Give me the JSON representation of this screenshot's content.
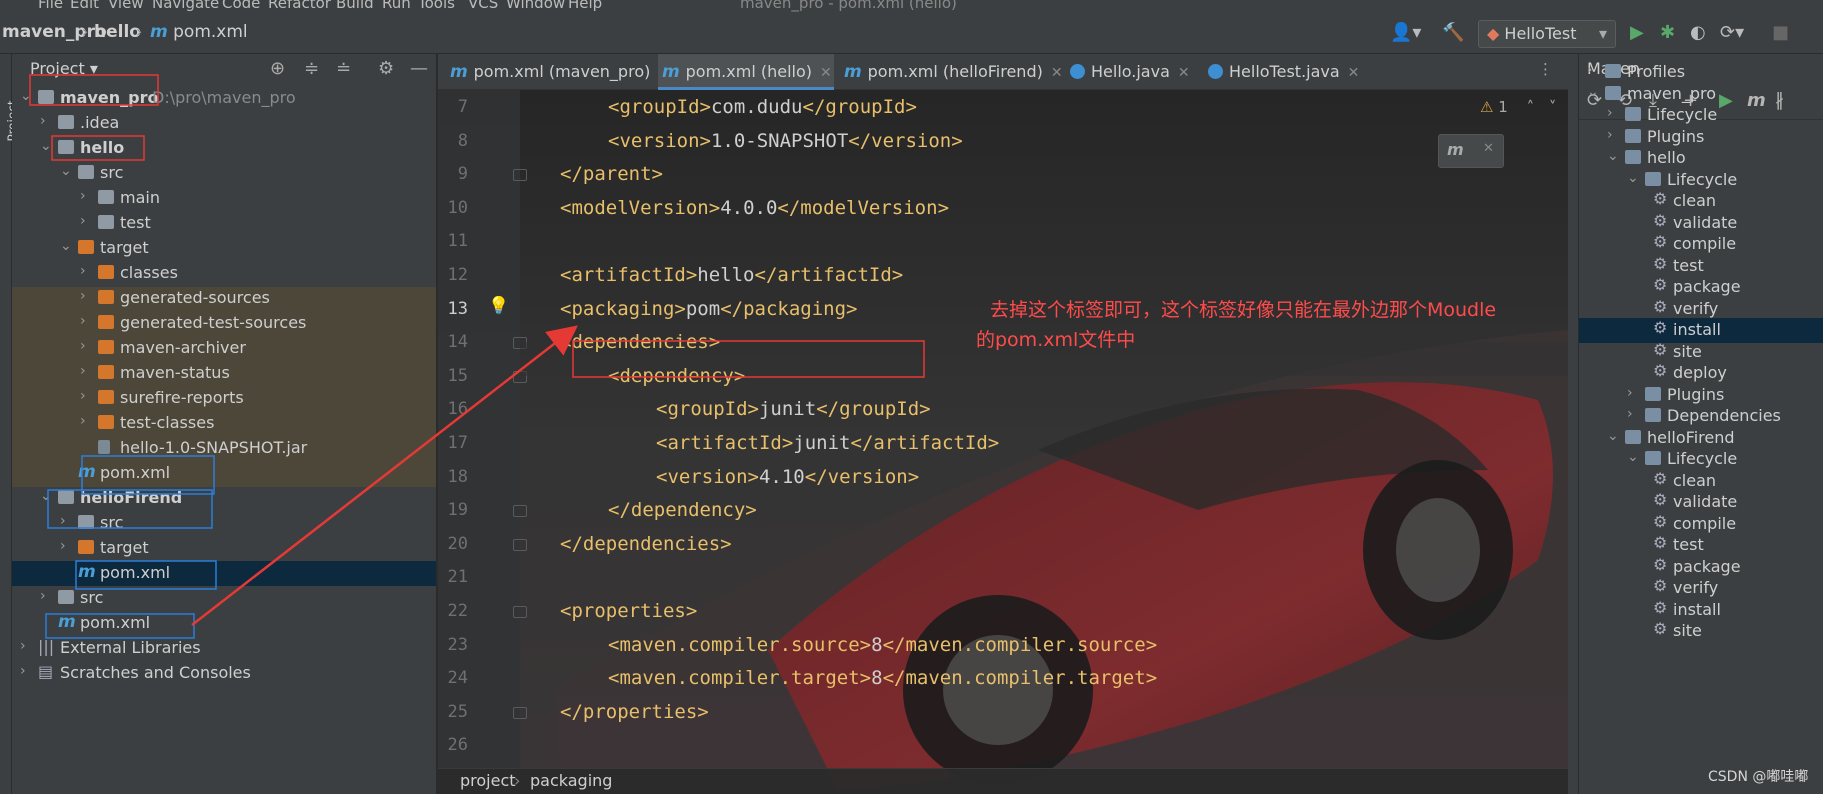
{
  "menu": {
    "items": [
      "File",
      "Edit",
      "View",
      "Navigate",
      "Code",
      "Refactor",
      "Build",
      "Run",
      "Tools",
      "VCS",
      "Window",
      "Help"
    ],
    "window_title": "maven_pro - pom.xml (hello)"
  },
  "navbar": {
    "crumbs": [
      "maven_pro",
      "hello",
      "pom.xml"
    ],
    "run_config": "HelloTest"
  },
  "project": {
    "title": "Project",
    "tree": [
      {
        "label": "maven_pro",
        "path": "D:\\pro\\maven_pro",
        "depth": 0,
        "expanded": true,
        "icon": "module-folder-icon",
        "bold": true
      },
      {
        "label": ".idea",
        "depth": 1,
        "expanded": false,
        "icon": "folder-icon"
      },
      {
        "label": "hello",
        "depth": 1,
        "expanded": true,
        "icon": "module-folder-icon",
        "bold": true
      },
      {
        "label": "src",
        "depth": 2,
        "expanded": true,
        "icon": "folder-icon"
      },
      {
        "label": "main",
        "depth": 3,
        "expanded": false,
        "icon": "folder-icon"
      },
      {
        "label": "test",
        "depth": 3,
        "expanded": false,
        "icon": "folder-icon"
      },
      {
        "label": "target",
        "depth": 2,
        "expanded": true,
        "icon": "excluded-folder-icon"
      },
      {
        "label": "classes",
        "depth": 3,
        "expanded": false,
        "icon": "excluded-folder-icon"
      },
      {
        "label": "generated-sources",
        "depth": 3,
        "expanded": false,
        "icon": "excluded-folder-icon"
      },
      {
        "label": "generated-test-sources",
        "depth": 3,
        "expanded": false,
        "icon": "excluded-folder-icon"
      },
      {
        "label": "maven-archiver",
        "depth": 3,
        "expanded": false,
        "icon": "excluded-folder-icon"
      },
      {
        "label": "maven-status",
        "depth": 3,
        "expanded": false,
        "icon": "excluded-folder-icon"
      },
      {
        "label": "surefire-reports",
        "depth": 3,
        "expanded": false,
        "icon": "excluded-folder-icon"
      },
      {
        "label": "test-classes",
        "depth": 3,
        "expanded": false,
        "icon": "excluded-folder-icon"
      },
      {
        "label": "hello-1.0-SNAPSHOT.jar",
        "depth": 3,
        "icon": "jar-icon"
      },
      {
        "label": "pom.xml",
        "depth": 2,
        "icon": "maven-file-icon"
      },
      {
        "label": "helloFirend",
        "depth": 1,
        "expanded": true,
        "icon": "module-folder-icon",
        "bold": true
      },
      {
        "label": "src",
        "depth": 2,
        "expanded": false,
        "icon": "folder-icon"
      },
      {
        "label": "target",
        "depth": 2,
        "expanded": false,
        "icon": "excluded-folder-icon"
      },
      {
        "label": "pom.xml",
        "depth": 2,
        "icon": "maven-file-icon",
        "selected": true
      },
      {
        "label": "src",
        "depth": 1,
        "expanded": false,
        "icon": "folder-icon"
      },
      {
        "label": "pom.xml",
        "depth": 1,
        "icon": "maven-file-icon"
      },
      {
        "label": "External Libraries",
        "depth": 0,
        "expanded": false,
        "icon": "library-icon"
      },
      {
        "label": "Scratches and Consoles",
        "depth": 0,
        "expanded": false,
        "icon": "scratches-icon"
      }
    ]
  },
  "tabs": [
    {
      "label": "pom.xml (maven_pro)",
      "icon": "maven-file-icon",
      "active": false
    },
    {
      "label": "pom.xml (hello)",
      "icon": "maven-file-icon",
      "active": true
    },
    {
      "label": "pom.xml (helloFirend)",
      "icon": "maven-file-icon",
      "active": false
    },
    {
      "label": "Hello.java",
      "icon": "java-class-icon",
      "active": false
    },
    {
      "label": "HelloTest.java",
      "icon": "java-class-icon",
      "active": false
    }
  ],
  "editor": {
    "inspection_count": "1",
    "current_line": 13,
    "lines": [
      {
        "n": "7",
        "indent": 1,
        "tag": "groupId",
        "text": "com.dudu"
      },
      {
        "n": "8",
        "indent": 1,
        "tag": "version",
        "text": "1.0-SNAPSHOT"
      },
      {
        "n": "9",
        "indent": 0,
        "close": "parent"
      },
      {
        "n": "10",
        "indent": 0,
        "tag": "modelVersion",
        "text": "4.0.0"
      },
      {
        "n": "11",
        "indent": 0
      },
      {
        "n": "12",
        "indent": 0,
        "tag": "artifactId",
        "text": "hello"
      },
      {
        "n": "13",
        "indent": 0,
        "tag": "packaging",
        "text": "pom"
      },
      {
        "n": "14",
        "indent": 0,
        "open": "dependencies"
      },
      {
        "n": "15",
        "indent": 1,
        "open": "dependency"
      },
      {
        "n": "16",
        "indent": 2,
        "tag": "groupId",
        "text": "junit"
      },
      {
        "n": "17",
        "indent": 2,
        "tag": "artifactId",
        "text": "junit"
      },
      {
        "n": "18",
        "indent": 2,
        "tag": "version",
        "text": "4.10"
      },
      {
        "n": "19",
        "indent": 1,
        "close": "dependency"
      },
      {
        "n": "20",
        "indent": 0,
        "close": "dependencies"
      },
      {
        "n": "21",
        "indent": 0
      },
      {
        "n": "22",
        "indent": 0,
        "open": "properties"
      },
      {
        "n": "23",
        "indent": 1,
        "tag": "maven.compiler.source",
        "text": "8"
      },
      {
        "n": "24",
        "indent": 1,
        "tag": "maven.compiler.target",
        "text": "8"
      },
      {
        "n": "25",
        "indent": 0,
        "close": "properties"
      },
      {
        "n": "26",
        "indent": 0
      }
    ],
    "breadcrumb": [
      "project",
      "packaging"
    ]
  },
  "annotation": {
    "line1": "去掉这个标签即可，这个标签好像只能在最外边那个Moudle",
    "line2": "的pom.xml文件中",
    "color": "#ff3b3b"
  },
  "maven": {
    "title": "Maven",
    "tree": [
      {
        "label": "Profiles",
        "depth": 0,
        "expanded": false,
        "icon": "profiles-icon"
      },
      {
        "label": "maven_pro",
        "depth": 0,
        "expanded": true,
        "icon": "maven-project-icon"
      },
      {
        "label": "Lifecycle",
        "depth": 1,
        "expanded": false,
        "icon": "lifecycle-icon"
      },
      {
        "label": "Plugins",
        "depth": 1,
        "expanded": false,
        "icon": "plugins-icon"
      },
      {
        "label": "hello",
        "depth": 1,
        "expanded": true,
        "icon": "maven-project-icon"
      },
      {
        "label": "Lifecycle",
        "depth": 2,
        "expanded": true,
        "icon": "lifecycle-icon"
      },
      {
        "label": "clean",
        "depth": 3,
        "icon": "gear-icon"
      },
      {
        "label": "validate",
        "depth": 3,
        "icon": "gear-icon"
      },
      {
        "label": "compile",
        "depth": 3,
        "icon": "gear-icon"
      },
      {
        "label": "test",
        "depth": 3,
        "icon": "gear-icon"
      },
      {
        "label": "package",
        "depth": 3,
        "icon": "gear-icon"
      },
      {
        "label": "verify",
        "depth": 3,
        "icon": "gear-icon"
      },
      {
        "label": "install",
        "depth": 3,
        "icon": "gear-icon",
        "selected": true
      },
      {
        "label": "site",
        "depth": 3,
        "icon": "gear-icon"
      },
      {
        "label": "deploy",
        "depth": 3,
        "icon": "gear-icon"
      },
      {
        "label": "Plugins",
        "depth": 2,
        "expanded": false,
        "icon": "plugins-icon"
      },
      {
        "label": "Dependencies",
        "depth": 2,
        "expanded": false,
        "icon": "dependencies-icon"
      },
      {
        "label": "helloFirend",
        "depth": 1,
        "expanded": true,
        "icon": "maven-project-icon"
      },
      {
        "label": "Lifecycle",
        "depth": 2,
        "expanded": true,
        "icon": "lifecycle-icon"
      },
      {
        "label": "clean",
        "depth": 3,
        "icon": "gear-icon"
      },
      {
        "label": "validate",
        "depth": 3,
        "icon": "gear-icon"
      },
      {
        "label": "compile",
        "depth": 3,
        "icon": "gear-icon"
      },
      {
        "label": "test",
        "depth": 3,
        "icon": "gear-icon"
      },
      {
        "label": "package",
        "depth": 3,
        "icon": "gear-icon"
      },
      {
        "label": "verify",
        "depth": 3,
        "icon": "gear-icon"
      },
      {
        "label": "install",
        "depth": 3,
        "icon": "gear-icon"
      },
      {
        "label": "site",
        "depth": 3,
        "icon": "gear-icon"
      }
    ]
  },
  "watermark": "CSDN @嘟哇嘟",
  "colors": {
    "tag": "#e8bf6a",
    "text": "#cfcfcf",
    "accent": "#4a88c7",
    "highlight_box": "#e53935",
    "selection_box": "#2d7ed9"
  }
}
